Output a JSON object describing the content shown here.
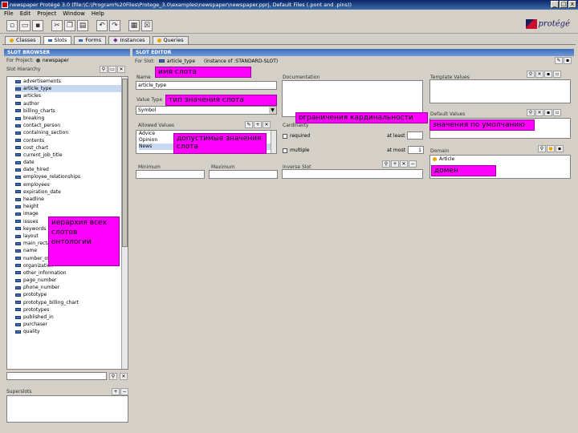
{
  "window": {
    "title": "newspaper  Protégé 3.0    (file:\\C:\\Program%20Files\\Protege_3.0\\examples\\newspaper\\newspaper.pprj, Default Files (.pont and .pins))",
    "buttons": [
      "_",
      "□",
      "x"
    ]
  },
  "menu": [
    "File",
    "Edit",
    "Project",
    "Window",
    "Help"
  ],
  "toolbar_icons": [
    "new-icon",
    "open-icon",
    "save-icon",
    "cut-icon",
    "copy-icon",
    "paste-icon",
    "undo-icon",
    "redo-icon",
    "config-icon",
    "delete-icon"
  ],
  "logo_text": "protégé",
  "tabs": [
    {
      "label": "Classes",
      "color": "#e6a800"
    },
    {
      "label": "Slots",
      "color": "#3d6bb8"
    },
    {
      "label": "Forms",
      "color": "#3d6bb8"
    },
    {
      "label": "Instances",
      "color": "#7a2a8a"
    },
    {
      "label": "Queries",
      "color": "#e6a800"
    }
  ],
  "slot_browser": {
    "header": "SLOT BROWSER",
    "project_label": "For Project:",
    "project_name": "newspaper",
    "hierarchy_label": "Slot Hierarchy",
    "slots": [
      "advertisements",
      "article_type",
      "articles",
      "author",
      "billing_charts",
      "breaking",
      "contact_person",
      "containing_section",
      "contents",
      "cost_chart",
      "current_job_title",
      "date",
      "date_hired",
      "employee_relationships",
      "employees",
      "expiration_date",
      "headline",
      "height",
      "image",
      "issues",
      "keywords",
      "layout",
      "main_rectangle",
      "name",
      "number_of_pages",
      "organization",
      "other_information",
      "page_number",
      "phone_number",
      "prototype",
      "prototype_billing_chart",
      "prototypes",
      "published_in",
      "purchaser",
      "quality"
    ],
    "selected_index": 1,
    "superslots_label": "Superslots"
  },
  "slot_editor": {
    "header": "SLOT EDITOR",
    "for_slot_label": "For Slot:",
    "for_slot_value": "article_type",
    "instance_of": "(instance of :STANDARD-SLOT)",
    "name_label": "Name",
    "name_value": "article_type",
    "documentation_label": "Documentation",
    "template_values_label": "Template Values",
    "value_type_label": "Value Type",
    "value_type_value": "Symbol",
    "cardinality_label": "Cardinality",
    "required_label": "required",
    "at_least_label": "at least",
    "multiple_label": "multiple",
    "at_most_label": "at most",
    "at_most_value": "1",
    "default_values_label": "Default Values",
    "allowed_values_label": "Allowed Values",
    "allowed_values": [
      "Advice",
      "Opinion",
      "News"
    ],
    "domain_label": "Domain",
    "domain_values": [
      "Article"
    ],
    "minimum_label": "Minimum",
    "maximum_label": "Maximum",
    "inverse_slot_label": "Inverse Slot"
  },
  "annotations": {
    "slot_name": "имя слота",
    "value_type": "тип значения слота",
    "cardinality": "ограничения кардинальности",
    "defaults": "значения по умолчанию",
    "allowed_values": "допустимые значения слота",
    "domain": "домен",
    "hierarchy": "иерархия всех слотов онтологии"
  },
  "colors": {
    "annotation": "#ff00ff",
    "panel_header": "#3d6bb8",
    "title_bar": "#0a246a"
  }
}
